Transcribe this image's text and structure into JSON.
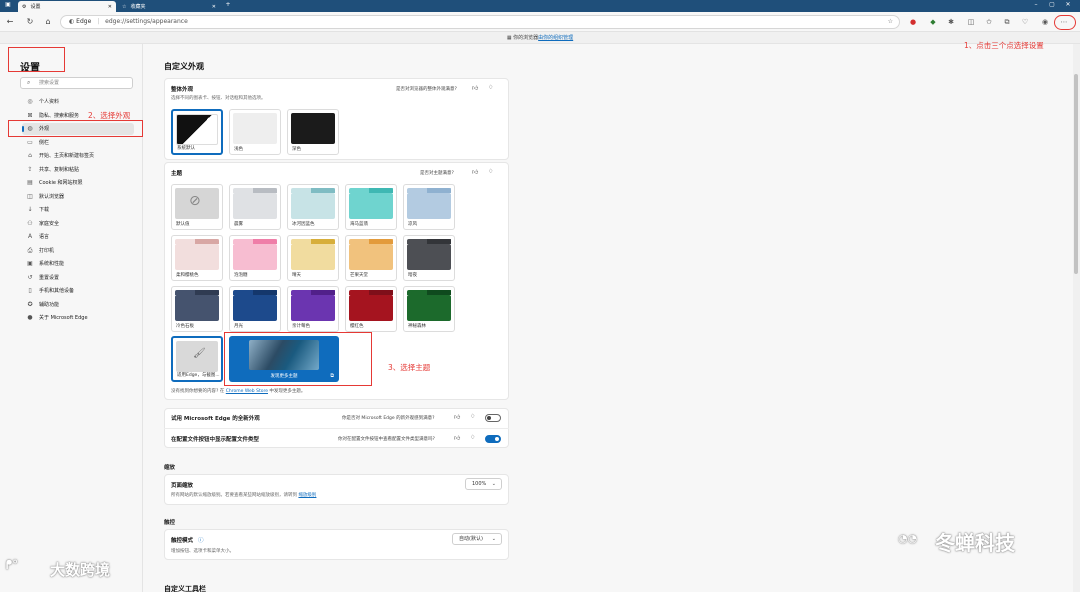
{
  "browser": {
    "tabs": [
      {
        "label": "设置",
        "active": true
      },
      {
        "label": "收藏夹",
        "active": false
      }
    ],
    "address": {
      "brand": "Edge",
      "url": "edge://settings/appearance"
    },
    "infobar": {
      "text": "你的浏览器",
      "link": "由你的组织管理"
    }
  },
  "sidebar": {
    "title": "设置",
    "search_placeholder": "搜索设置",
    "items": [
      {
        "label": "个人资料",
        "icon": "profile-icon",
        "glyph": "◎"
      },
      {
        "label": "隐私、搜索和服务",
        "icon": "lock-icon",
        "glyph": "⊠"
      },
      {
        "label": "外观",
        "icon": "appearance-icon",
        "glyph": "◍"
      },
      {
        "label": "侧栏",
        "icon": "sidebar-icon",
        "glyph": "▭"
      },
      {
        "label": "开始、主页和新建标签页",
        "icon": "home-icon",
        "glyph": "⌂"
      },
      {
        "label": "共享、复制和粘贴",
        "icon": "share-icon",
        "glyph": "⇪"
      },
      {
        "label": "Cookie 和网站权限",
        "icon": "cookie-icon",
        "glyph": "▤"
      },
      {
        "label": "默认浏览器",
        "icon": "browser-icon",
        "glyph": "◫"
      },
      {
        "label": "下载",
        "icon": "download-icon",
        "glyph": "↓"
      },
      {
        "label": "家庭安全",
        "icon": "family-icon",
        "glyph": "⚇"
      },
      {
        "label": "语言",
        "icon": "language-icon",
        "glyph": "A"
      },
      {
        "label": "打印机",
        "icon": "printer-icon",
        "glyph": "⎙"
      },
      {
        "label": "系统和性能",
        "icon": "system-icon",
        "glyph": "▣"
      },
      {
        "label": "重置设置",
        "icon": "reset-icon",
        "glyph": "↺"
      },
      {
        "label": "手机和其他设备",
        "icon": "phone-icon",
        "glyph": "▯"
      },
      {
        "label": "辅助功能",
        "icon": "accessibility-icon",
        "glyph": "✪"
      },
      {
        "label": "关于 Microsoft Edge",
        "icon": "edge-icon",
        "glyph": "●"
      }
    ]
  },
  "main": {
    "heading": "自定义外观",
    "overall": {
      "title": "整体外观",
      "desc": "选择不同的图表卡、按钮、对话框和其他选项。",
      "feedback": "是否对浏览器的整体外观满意?",
      "options": [
        {
          "label": "系统默认",
          "selected": true
        },
        {
          "label": "浅色",
          "selected": false
        },
        {
          "label": "深色",
          "selected": false
        }
      ]
    },
    "themes": {
      "title": "主题",
      "feedback": "是否对主题满意?",
      "items": [
        {
          "label": "默认值",
          "tab": "#cfcfcf",
          "front": "#d6d6d6"
        },
        {
          "label": "晨雾",
          "tab": "#b8bcc2",
          "front": "#dfe1e4"
        },
        {
          "label": "冰河因蓝色",
          "tab": "#7fbcc3",
          "front": "#c7e3e6"
        },
        {
          "label": "海马蓝翡",
          "tab": "#3fb8b3",
          "front": "#6fd4cf"
        },
        {
          "label": "凉风",
          "tab": "#8fb1d0",
          "front": "#b3cbe1"
        },
        {
          "label": "柔和樱桃色",
          "tab": "#d8a7a4",
          "front": "#f2dedd"
        },
        {
          "label": "泡泡糖",
          "tab": "#ef7ea8",
          "front": "#f7bdd1"
        },
        {
          "label": "晴天",
          "tab": "#d7ae3a",
          "front": "#f1dc9f"
        },
        {
          "label": "芒果天堂",
          "tab": "#e39b3c",
          "front": "#f1c27d"
        },
        {
          "label": "暗夜",
          "tab": "#333539",
          "front": "#4d4f54"
        },
        {
          "label": "冷色石板",
          "tab": "#2f3b52",
          "front": "#45536e"
        },
        {
          "label": "月光",
          "tab": "#14376c",
          "front": "#1d4a8c"
        },
        {
          "label": "亲计莓色",
          "tab": "#51208a",
          "front": "#6b35b0"
        },
        {
          "label": "樱红色",
          "tab": "#7f0f1a",
          "front": "#a5141f"
        },
        {
          "label": "神秘森林",
          "tab": "#0f4a1e",
          "front": "#1c6a2c"
        }
      ],
      "edge_theme": {
        "label": "适用Edge，与截图...",
        "icon": "brush-icon"
      },
      "discover": {
        "label": "发现更多主题"
      },
      "hint_prefix": "没有找到你想要的内容? 在",
      "hint_link": "Chrome Web Store",
      "hint_suffix": "中发现更多主题。"
    },
    "try_new": {
      "label": "试用 Microsoft Edge 的全新外观",
      "feedback": "你是否对 Microsoft Edge 的新外观感到满意?",
      "on": false
    },
    "profile_type": {
      "label": "在配置文件按钮中显示配置文件类型",
      "feedback": "你对在配置文件按钮中查看配置文件类型满意吗?",
      "on": true
    },
    "zoom": {
      "group": "缩放",
      "title": "页面缩放",
      "desc": "所有网站的默认缩放级别。若要查看某些网站缩放级别，请转到",
      "link": "缩放级别",
      "value": "100%"
    },
    "touch": {
      "group": "触控",
      "title": "触控模式",
      "desc": "增加按钮、选项卡和菜单大小。",
      "value": "自动(默认)"
    },
    "more_heading": "自定义工具栏"
  },
  "annotations": {
    "a1": "1、点击三个点选择设置",
    "a2": "2、选择外观",
    "a3": "3、选择主题"
  },
  "watermarks": {
    "left": "大数跨境",
    "right": "冬蝉科技"
  },
  "colors": {
    "accent": "#0f6cbd",
    "annotation": "#e53935",
    "titlebar": "#1f4f7a"
  }
}
